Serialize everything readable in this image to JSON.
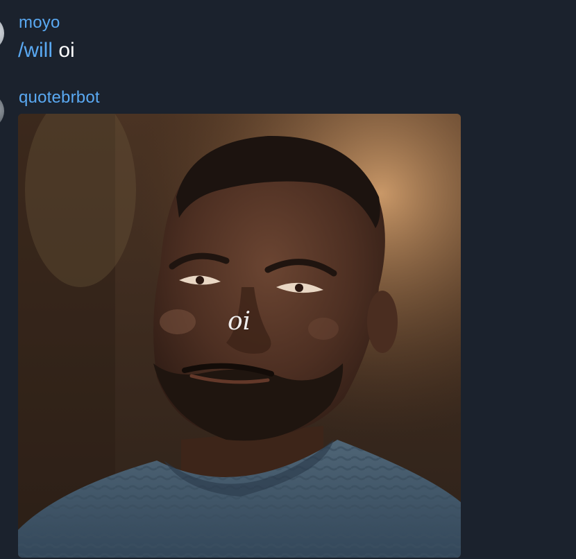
{
  "messages": [
    {
      "sender": "moyo",
      "command": "/will",
      "text": "oi"
    },
    {
      "sender": "quotebrbot",
      "image_caption": "oi"
    }
  ],
  "colors": {
    "background": "#1b222d",
    "sender_name": "#5aa9f2",
    "command_link": "#5aa9f2",
    "message_text": "#ffffff"
  }
}
